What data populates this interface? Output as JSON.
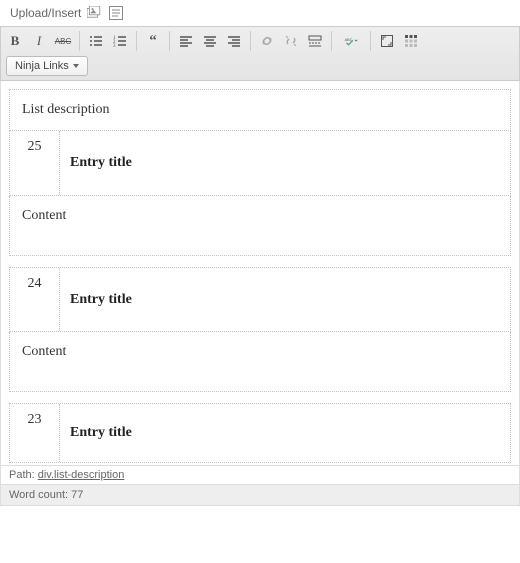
{
  "upload": {
    "label": "Upload/Insert"
  },
  "toolbar": {
    "ninja_label": "Ninja Links",
    "buttons_row1": [
      "bold",
      "italic",
      "strike",
      "ul",
      "ol",
      "quote",
      "align-left",
      "align-center",
      "align-right",
      "link",
      "unlink",
      "more",
      "spellcheck",
      "fullscreen",
      "kitchensink"
    ]
  },
  "editor": {
    "list_description": "List description",
    "content_label": "Content",
    "entries": [
      {
        "num": "25",
        "title": "Entry title"
      },
      {
        "num": "24",
        "title": "Entry title"
      },
      {
        "num": "23",
        "title": "Entry title"
      }
    ]
  },
  "status": {
    "path_prefix": "Path: ",
    "path_value": "div.list-description",
    "word_count_prefix": "Word count: ",
    "word_count": "77"
  }
}
